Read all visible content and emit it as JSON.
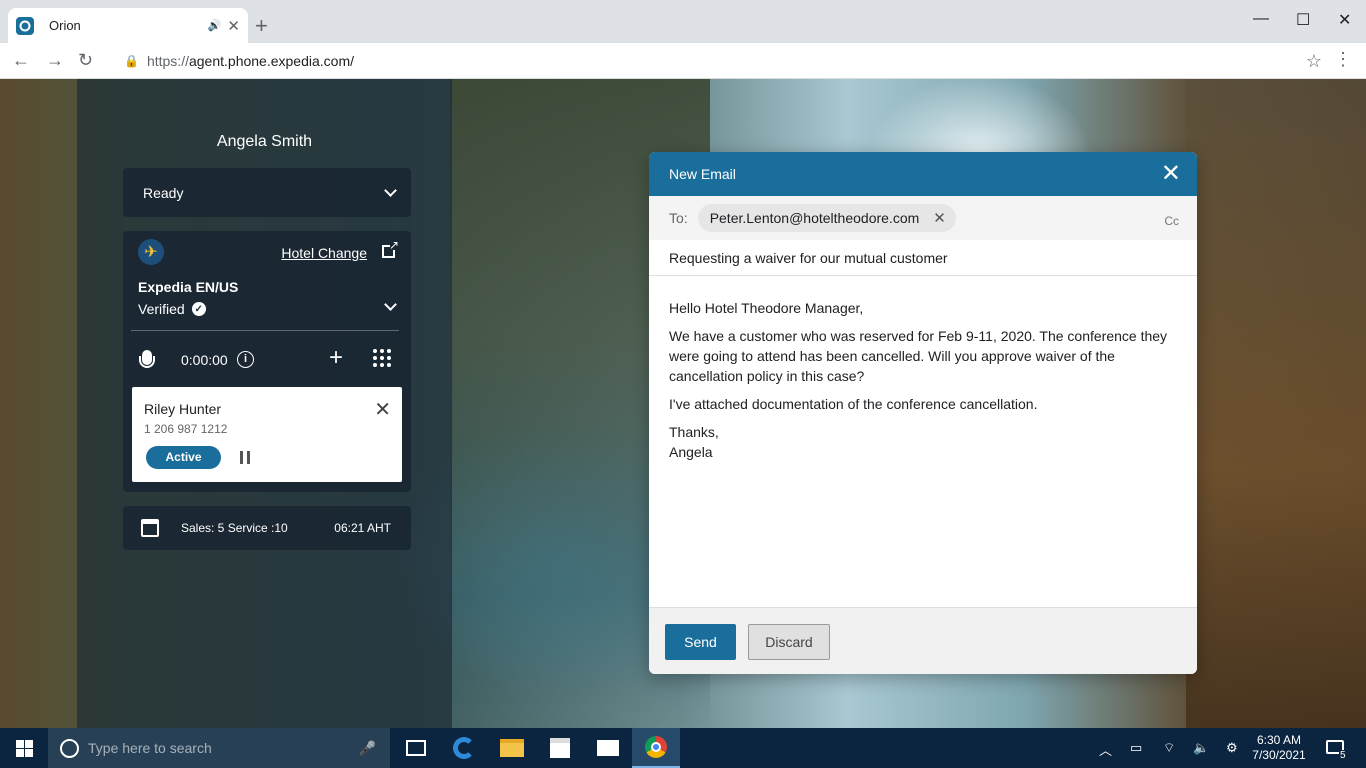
{
  "browser": {
    "tab_title": "Orion",
    "url_prefix": "https://",
    "url_host": "agent.phone.expedia.com/"
  },
  "agent": {
    "name": "Angela Smith",
    "status": "Ready",
    "hotel_change_label": "Hotel Change",
    "site_name": "Expedia EN/US",
    "verified_label": "Verified",
    "call_timer": "0:00:00",
    "caller": {
      "name": "Riley Hunter",
      "phone": "1 206 987 1212",
      "state_label": "Active"
    },
    "stats": {
      "sales_service": "Sales: 5  Service :10",
      "aht": "06:21 AHT"
    }
  },
  "email": {
    "title": "New Email",
    "to_label": "To:",
    "recipient": "Peter.Lenton@hoteltheodore.com",
    "cc_label": "Cc",
    "subject": "Requesting a waiver for our mutual customer",
    "body": {
      "greeting": "Hello Hotel Theodore Manager,",
      "para1": "We have a customer who was reserved for Feb 9-11, 2020. The conference they were going to attend has been cancelled. Will you approve waiver of the cancellation policy in this case?",
      "para2": "I've attached documentation of the conference cancellation.",
      "closing": "Thanks,",
      "signature": "Angela"
    },
    "send_label": "Send",
    "discard_label": "Discard"
  },
  "taskbar": {
    "search_placeholder": "Type here to search",
    "time": "6:30 AM",
    "date": "7/30/2021",
    "notification_count": "5"
  },
  "colors": {
    "accent": "#1a6e9c",
    "taskbar": "#0b2540"
  }
}
